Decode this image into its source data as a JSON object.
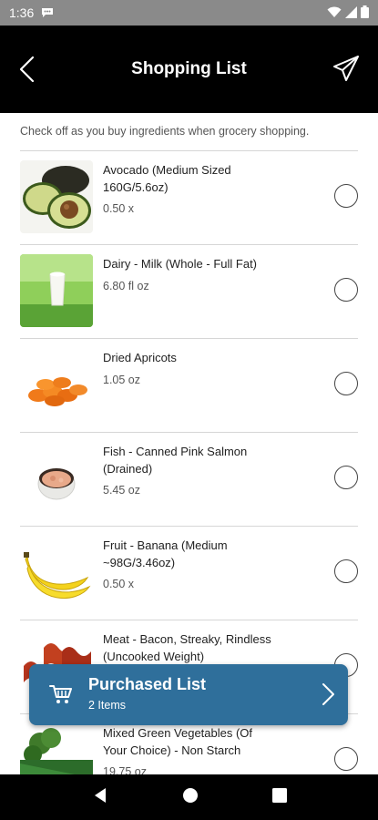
{
  "status_bar": {
    "time": "1:36"
  },
  "header": {
    "title": "Shopping List"
  },
  "instructions": "Check off as you buy ingredients when grocery shopping.",
  "items": [
    {
      "name": "Avocado (Medium Sized 160G/5.6oz)",
      "qty": "0.50 x",
      "image": "avocado"
    },
    {
      "name": "Dairy - Milk (Whole - Full Fat)",
      "qty": "6.80 fl oz",
      "image": "milk"
    },
    {
      "name": "Dried Apricots",
      "qty": "1.05 oz",
      "image": "apricots"
    },
    {
      "name": "Fish - Canned Pink Salmon (Drained)",
      "qty": "5.45 oz",
      "image": "salmon"
    },
    {
      "name": "Fruit - Banana (Medium ~98G/3.46oz)",
      "qty": "0.50 x",
      "image": "banana"
    },
    {
      "name": "Meat - Bacon, Streaky, Rindless (Uncooked Weight)",
      "qty": "",
      "image": "bacon"
    },
    {
      "name": "Mixed Green Vegetables (Of Your Choice) - Non Starch",
      "qty": "19.75 oz",
      "image": "greens"
    }
  ],
  "purchased_list": {
    "title": "Purchased List",
    "count": "2 Items"
  },
  "colors": {
    "header_bg": "#000000",
    "accent": "#2f6f9b"
  }
}
